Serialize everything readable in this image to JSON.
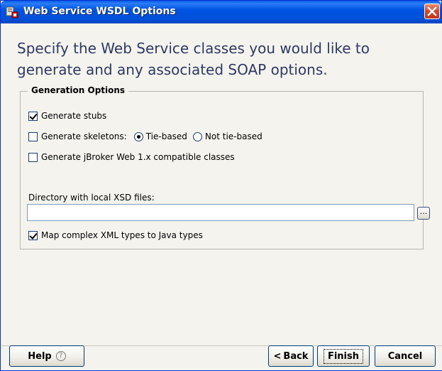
{
  "window": {
    "title": "Web Service WSDL Options",
    "icon": "wsdl-app-icon",
    "close_icon": "close-icon"
  },
  "heading": "Specify the Web Service classes you would like to generate and any associated SOAP options.",
  "group": {
    "legend": "Generation Options",
    "generate_stubs": {
      "label": "Generate stubs",
      "checked": true
    },
    "generate_skeletons": {
      "label": "Generate skeletons:",
      "checked": false
    },
    "skeleton_mode": {
      "options": [
        "Tie-based",
        "Not tie-based"
      ],
      "selected": "Tie-based"
    },
    "jbroker": {
      "label": "Generate jBroker Web 1.x compatible classes",
      "checked": false
    },
    "xsd_dir": {
      "label": "Directory with local XSD files:",
      "value": "",
      "browse_label": "..."
    },
    "map_types": {
      "label": "Map complex XML types to Java types",
      "checked": true
    }
  },
  "footer": {
    "help_label": "Help",
    "help_icon": "question-mark-icon",
    "back_label": "Back",
    "back_prefix": "<",
    "finish_label": "Finish",
    "cancel_label": "Cancel"
  },
  "colors": {
    "titlebar": "#0054e3",
    "heading_text": "#2e3a63",
    "background": "#f4f3ee"
  }
}
